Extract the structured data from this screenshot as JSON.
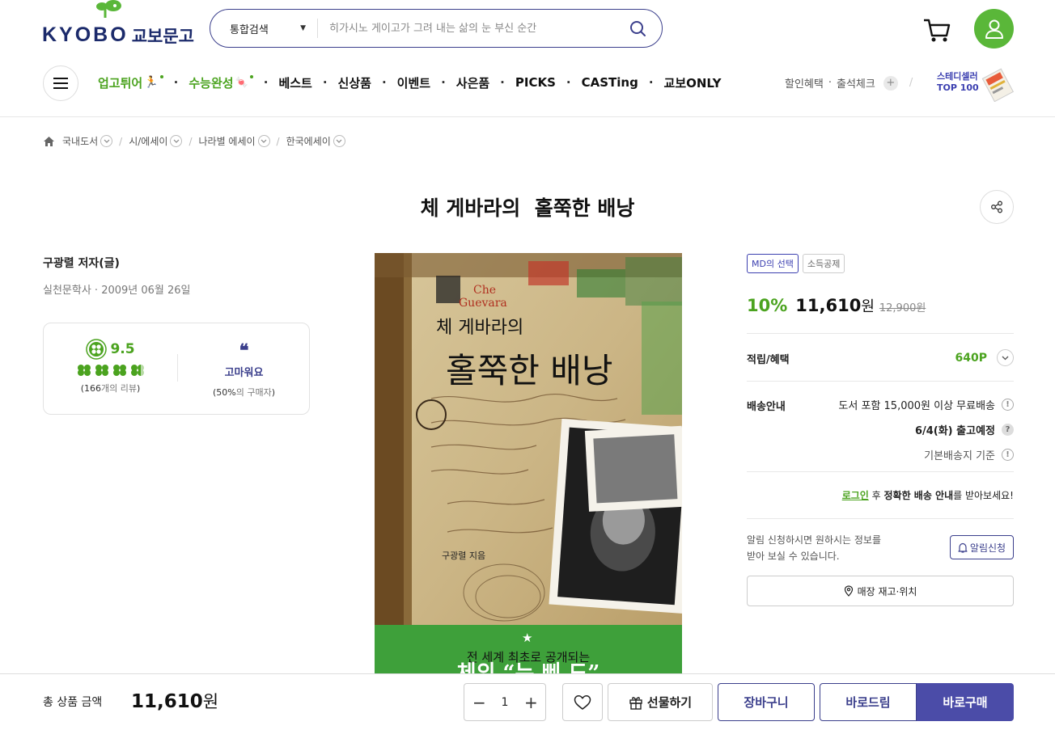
{
  "header": {
    "logo_en": "KYOBO",
    "logo_ko": "교보문고",
    "search": {
      "category": "통합검색",
      "placeholder": "히가시노 게이고가 그려 내는 삶의 눈 부신 순간"
    }
  },
  "nav": {
    "items": [
      {
        "label": "업고튀어",
        "style": "green"
      },
      {
        "label": "수능완성",
        "style": "green"
      },
      {
        "label": "베스트"
      },
      {
        "label": "신상품"
      },
      {
        "label": "이벤트"
      },
      {
        "label": "사은품"
      },
      {
        "label": "PICKS"
      },
      {
        "label": "CASTing"
      },
      {
        "label": "교보ONLY"
      }
    ],
    "right": {
      "discount": "할인혜택",
      "checkin": "출석체크",
      "plus": "+",
      "slash": "/"
    },
    "steady": {
      "line1": "스테디셀러",
      "line2": "TOP 100"
    }
  },
  "breadcrumb": [
    "국내도서",
    "시/에세이",
    "나라별 에세이",
    "한국에세이"
  ],
  "product": {
    "title": "체 게바라의  홀쭉한 배낭",
    "author": "구광렬 저자(글)",
    "publisher": "실천문학사 · 2009년 06월 26일",
    "rating": {
      "score": "9.5",
      "review_count": "166",
      "review_suffix": "개의 리뷰",
      "tag_label": "고마워요",
      "tag_percent": "50%",
      "tag_suffix": "의 구매자"
    },
    "cover": {
      "che": "Che",
      "guevara": "Guevara",
      "title_small": "체 게바라의",
      "title_big": "홀쭉한 배낭",
      "author": "구광렬 지음",
      "tagline": "전 세계 최초로 공개되는",
      "tagline2": "체의 “누 삐 드”"
    }
  },
  "purchase": {
    "badges": [
      "MD의 선택",
      "소득공제"
    ],
    "discount_rate": "10%",
    "price": "11,610",
    "won": "원",
    "original_price": "12,900원",
    "points_label": "적립/혜택",
    "points_value": "640P",
    "shipping_label": "배송안내",
    "shipping_free": "도서 포함 15,000원 이상 무료배송",
    "shipping_date": "6/4(화) 출고예정",
    "shipping_base": "기본배송지 기준",
    "login_link": "로그인",
    "login_mid": " 후 ",
    "login_bold": "정확한 배송 안내",
    "login_end": "를 받아보세요!",
    "alert_text_1": "알림 신청하시면 원하시는 정보를",
    "alert_text_2": "받아 보실 수 있습니다.",
    "alert_button": "알림신청",
    "store_button": "매장 재고·위치"
  },
  "bottom_bar": {
    "total_label": "총 상품 금액",
    "total_value": "11,610",
    "total_won": "원",
    "quantity": "1",
    "gift_label": "선물하기",
    "cart_label": "장바구니",
    "bd_label": "바로드림",
    "buy_label": "바로구매"
  },
  "colors": {
    "accent_green": "#4ba31f",
    "brand_navy": "#3b3f8c",
    "buy_button": "#4b4ca8"
  }
}
